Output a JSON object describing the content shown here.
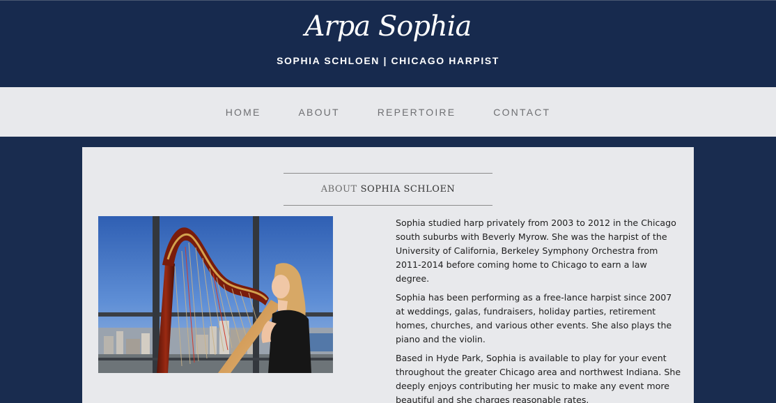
{
  "header": {
    "title": "Arpa Sophia",
    "subtitle": "SOPHIA SCHLOEN | CHICAGO HARPIST"
  },
  "nav": {
    "items": [
      {
        "label": "HOME"
      },
      {
        "label": "ABOUT"
      },
      {
        "label": "REPERTOIRE"
      },
      {
        "label": "CONTACT"
      }
    ]
  },
  "about": {
    "heading_prefix": "ABOUT",
    "heading_name": "SOPHIA SCHLOEN",
    "paragraphs": [
      "Sophia studied harp privately from 2003 to 2012 in the Chicago south suburbs with Beverly Myrow. She was the harpist of the University of California, Berkeley Symphony Orchestra from 2011-2014 before coming home to Chicago to earn a law degree.",
      "Sophia has been performing as a free-lance harpist since 2007 at weddings, galas, fundraisers, holiday parties, retirement homes, churches, and various other events. She also plays the piano and the violin.",
      "Based in Hyde Park, Sophia is available to play for your event throughout the greater Chicago area and northwest Indiana. She deeply enjoys contributing her music to make any event more beautiful and she charges reasonable rates."
    ]
  },
  "colors": {
    "header_bg": "#172a4e",
    "nav_bg": "#e8e9ec",
    "panel_bg": "#e8e9ec",
    "nav_text": "#6e6f72"
  }
}
